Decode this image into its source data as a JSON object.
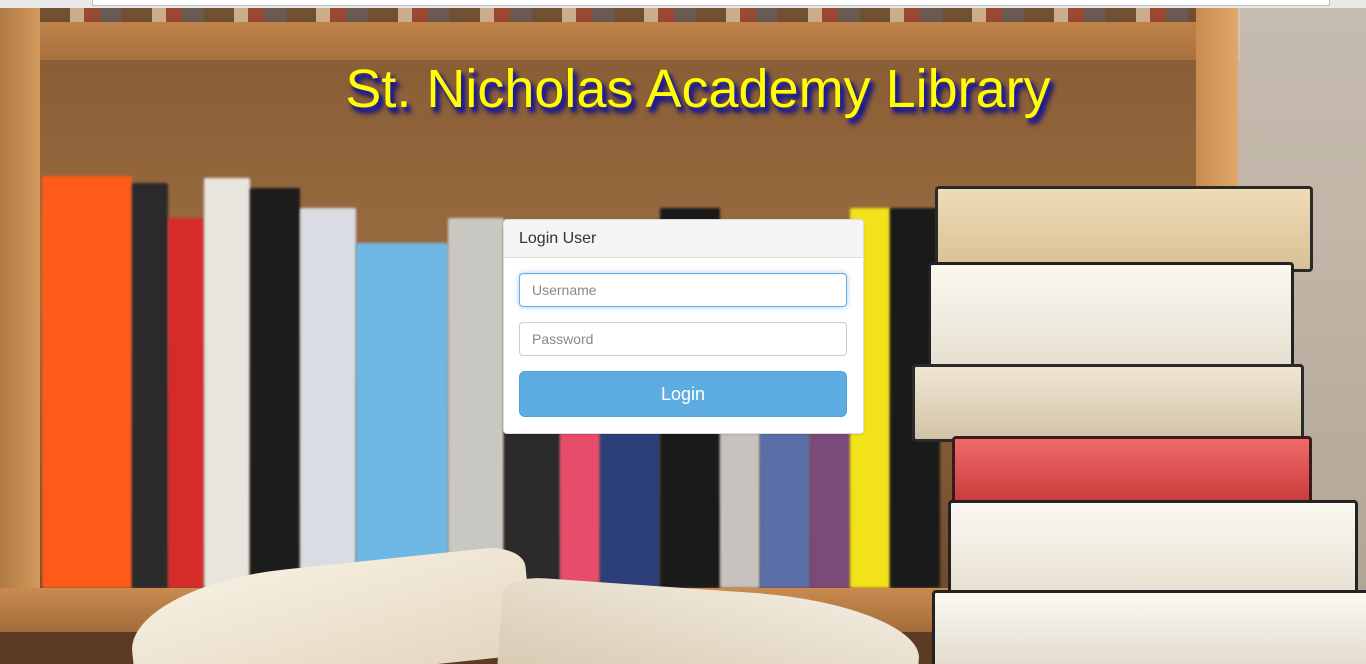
{
  "page": {
    "title": "St. Nicholas Academy Library"
  },
  "login_panel": {
    "heading": "Login User",
    "username_placeholder": "Username",
    "password_placeholder": "Password",
    "login_label": "Login"
  },
  "colors": {
    "title_text": "#ffff00",
    "title_shadow": "#1a1aa0",
    "login_button": "#5dade2",
    "input_focus_border": "#66afe9"
  }
}
